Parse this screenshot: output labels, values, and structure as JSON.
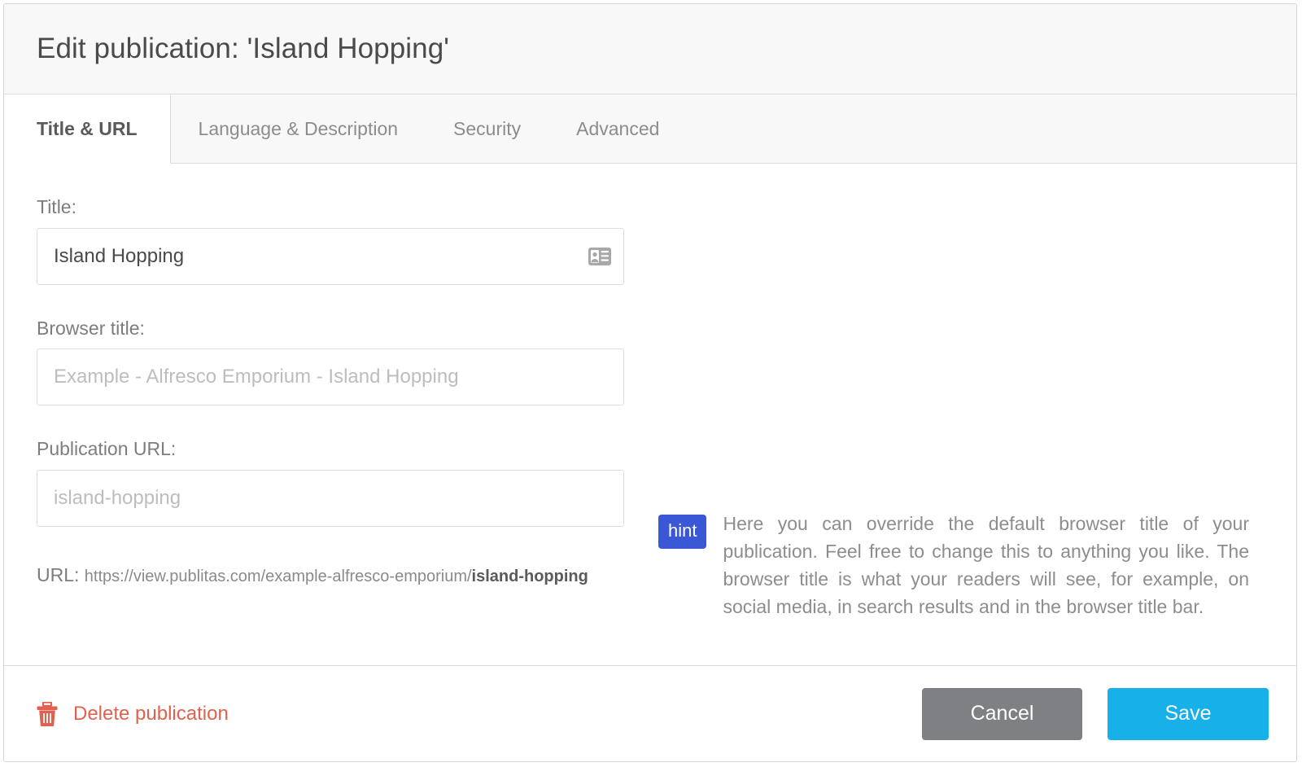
{
  "header": {
    "title": "Edit publication: 'Island Hopping'"
  },
  "tabs": [
    {
      "label": "Title & URL",
      "active": true
    },
    {
      "label": "Language & Description",
      "active": false
    },
    {
      "label": "Security",
      "active": false
    },
    {
      "label": "Advanced",
      "active": false
    }
  ],
  "form": {
    "title_field": {
      "label": "Title:",
      "value": "Island Hopping",
      "placeholder": "",
      "icon": "contact-card-icon"
    },
    "browser_title_field": {
      "label": "Browser title:",
      "value": "",
      "placeholder": "Example - Alfresco Emporium - Island Hopping"
    },
    "publication_url_field": {
      "label": "Publication URL:",
      "value": "",
      "placeholder": "island-hopping"
    },
    "url_preview": {
      "label": "URL:",
      "base": "https://view.publitas.com/example-alfresco-emporium/",
      "slug": "island-hopping"
    }
  },
  "hint": {
    "badge": "hint",
    "text": "Here you can override the default browser title of your publication. Feel free to change this to anything you like. The browser title is what your readers will see, for example, on social media, in search results and in the browser title bar."
  },
  "footer": {
    "delete_label": "Delete publication",
    "delete_icon": "trash-icon",
    "cancel_label": "Cancel",
    "save_label": "Save"
  },
  "colors": {
    "hint_badge": "#3a57d6",
    "delete": "#e2614e",
    "save": "#18b0e8",
    "cancel": "#7f8083"
  }
}
